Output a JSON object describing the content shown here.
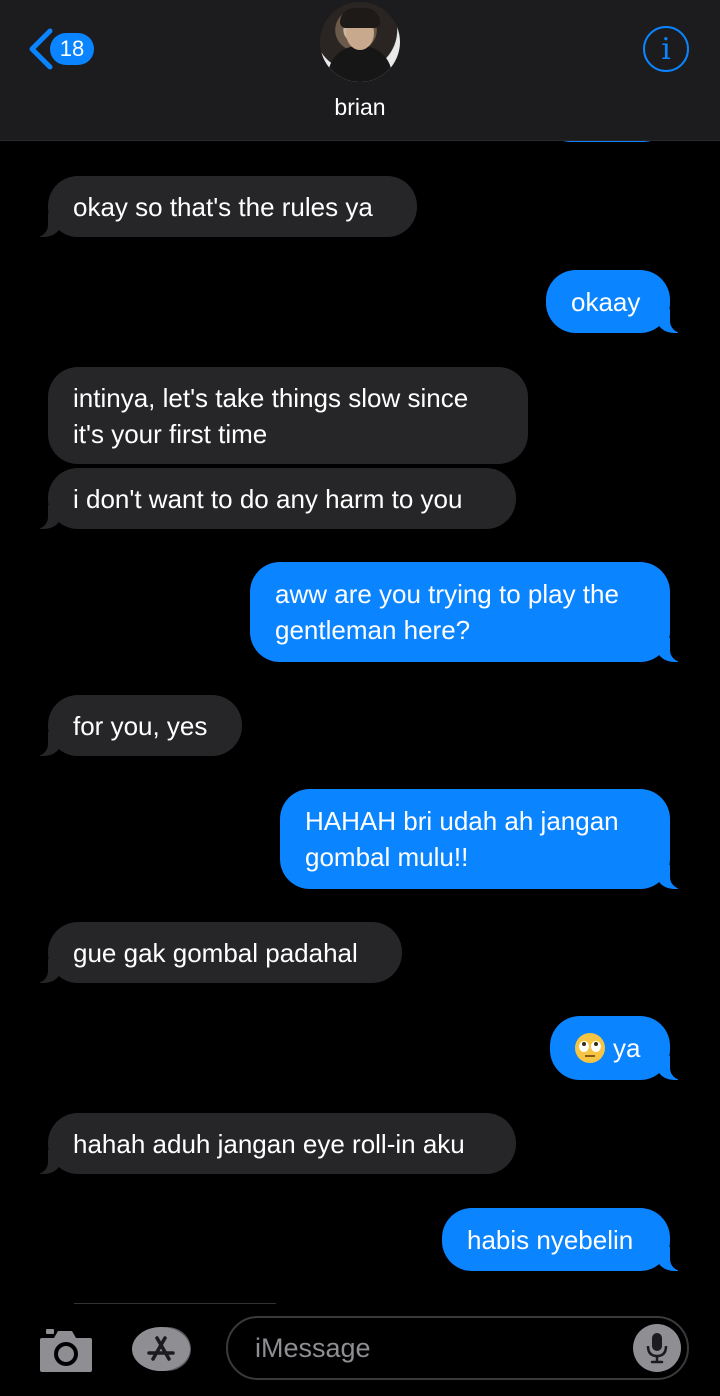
{
  "header": {
    "back_badge": "18",
    "contact_name": "brian",
    "info_label": "i"
  },
  "messages": [
    {
      "side": "in",
      "text": "okay so that's the rules ya"
    },
    {
      "side": "out",
      "text": "okaay"
    },
    {
      "side": "in",
      "text": "intinya, let's take things slow since it's your first time"
    },
    {
      "side": "in",
      "text": "i don't want to do any harm to you"
    },
    {
      "side": "out",
      "text": "aww are you trying to play the gentleman here?"
    },
    {
      "side": "in",
      "text": "for you, yes"
    },
    {
      "side": "out",
      "text": "HAHAH bri udah ah jangan gombal mulu!!"
    },
    {
      "side": "in",
      "text": "gue gak gombal padahal"
    },
    {
      "side": "out",
      "emoji": "face-with-rolling-eyes",
      "text": "ya"
    },
    {
      "side": "in",
      "text": "hahah aduh jangan eye roll-in aku"
    },
    {
      "side": "out",
      "text": "habis nyebelin"
    }
  ],
  "composer": {
    "placeholder": "iMessage"
  },
  "colors": {
    "accent": "#0a84ff",
    "incoming_bubble": "#262628",
    "background": "#000000",
    "header": "#1c1c1e"
  }
}
